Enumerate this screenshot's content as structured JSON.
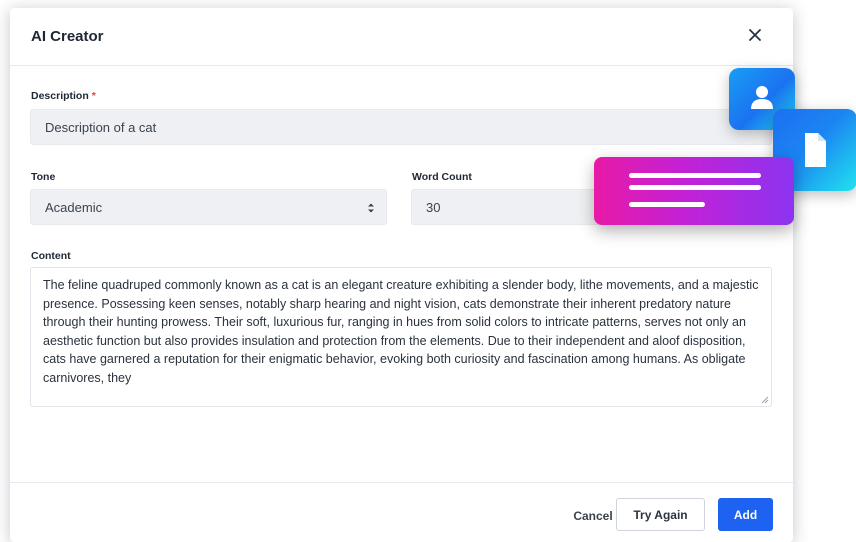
{
  "dialog": {
    "title": "AI Creator",
    "close_icon": "close-icon"
  },
  "form": {
    "description": {
      "label": "Description",
      "required_mark": "*",
      "value": "Description of a cat"
    },
    "tone": {
      "label": "Tone",
      "value": "Academic",
      "icon": "select-arrows-icon"
    },
    "word_count": {
      "label": "Word Count",
      "value": "30"
    },
    "content": {
      "label": "Content",
      "text": "The feline quadruped commonly known as a cat is an elegant creature exhibiting a slender body, lithe movements, and a majestic presence. Possessing keen senses, notably sharp hearing and night vision, cats demonstrate their inherent predatory nature through their hunting prowess. Their soft, luxurious fur, ranging in hues from solid colors to intricate patterns, serves not only an aesthetic function but also provides insulation and protection from the elements. Due to their independent and aloof disposition, cats have garnered a reputation for their enigmatic behavior, evoking both curiosity and fascination among humans. As obligate carnivores, they"
    }
  },
  "footer": {
    "cancel_label": "Cancel",
    "try_again_label": "Try Again",
    "add_label": "Add"
  },
  "colors": {
    "primary": "#1d62f0",
    "required": "#e0473a",
    "accent_magenta": "#e81aa6",
    "accent_cyan": "#21e3ee"
  },
  "decorations": {
    "user_icon": "user-icon",
    "document_icon": "document-icon",
    "text_lines_icon": "text-lines-icon"
  }
}
